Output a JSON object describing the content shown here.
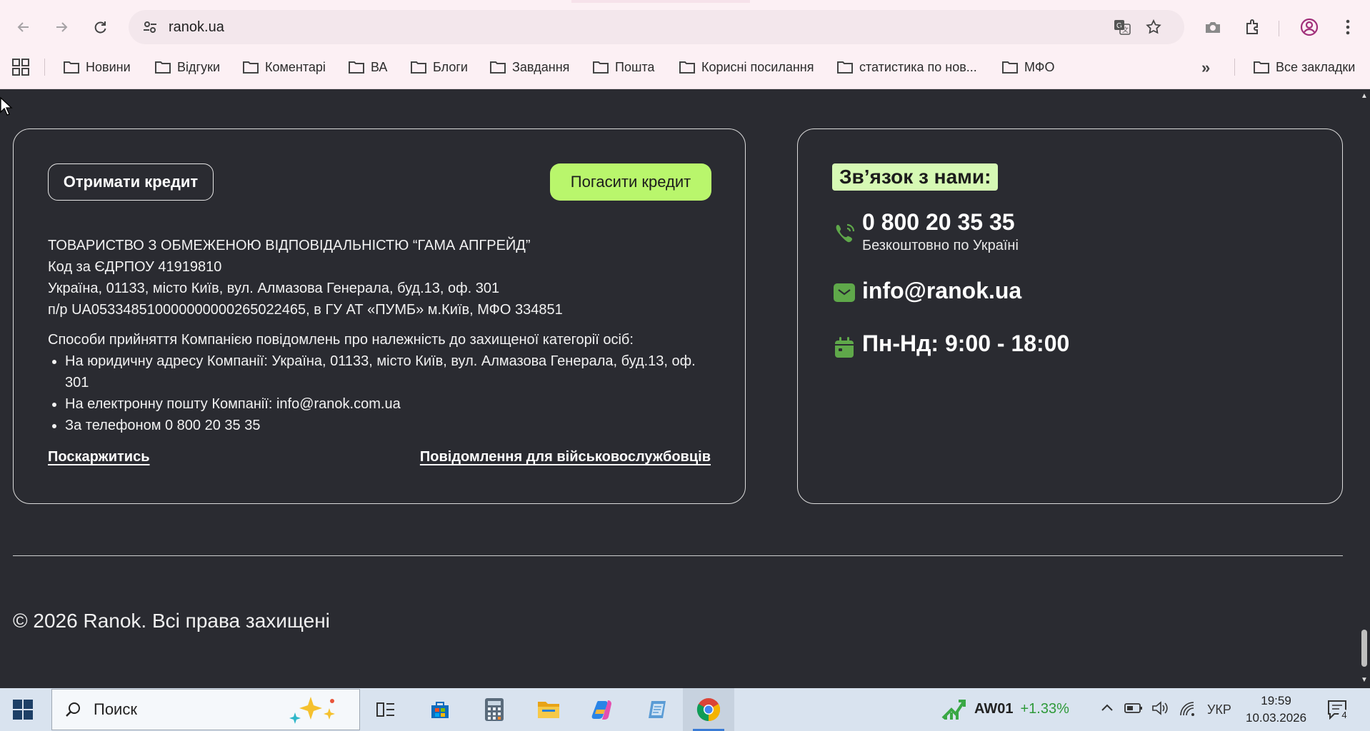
{
  "browser": {
    "url": "ranok.ua",
    "bookmarks": [
      "Новини",
      "Відгуки",
      "Коментарі",
      "ВА",
      "Блоги",
      "Завдання",
      "Пошта",
      "Корисні посилання",
      "статистика по нов...",
      "МФО"
    ],
    "all_bookmarks": "Все закладки"
  },
  "footer": {
    "get_credit": "Отримати кредит",
    "repay_credit": "Погасити кредит",
    "company_lines": [
      "ТОВАРИСТВО З ОБМЕЖЕНОЮ ВІДПОВІДАЛЬНІСТЮ “ГАМА АПГРЕЙД”",
      "Код за ЄДРПОУ 41919810",
      "Україна, 01133, місто Київ, вул. Алмазова Генерала, буд.13, оф. 301",
      "п/р UA053348510000000000265022465, в ГУ АТ «ПУМБ» м.Київ, МФО 334851"
    ],
    "ways_title": "Способи прийняття Компанією повідомлень про належність до захищеної категорії осіб:",
    "ways": [
      "На юридичну адресу Компанії: Україна, 01133, місто Київ, вул. Алмазова Генерала, буд.13, оф. 301",
      "На електронну пошту Компанії: info@ranok.com.ua",
      "За телефоном 0 800 20 35 35"
    ],
    "complain_link": "Поскаржитись",
    "military_link": "Повідомлення для військовослужбовців",
    "contact_heading": "Зв’язок з нами:",
    "phone": "0 800 20 35 35",
    "phone_note": "Безкоштовно по Україні",
    "email": "info@ranok.ua",
    "hours": "Пн-Нд: 9:00 - 18:00",
    "copyright": "© 2026 Ranok. Всі права захищені"
  },
  "taskbar": {
    "search_label": "Поиск",
    "stock_name": "AW01",
    "stock_change": "+1.33%",
    "language": "УКР",
    "time": "19:59",
    "date": "10.03.2026",
    "notifications": "4"
  },
  "colors": {
    "page_bg": "#2a2b31",
    "accent_green": "#b9f66c",
    "heading_highlight": "#d6f9b4",
    "icon_green": "#5fa84a"
  }
}
